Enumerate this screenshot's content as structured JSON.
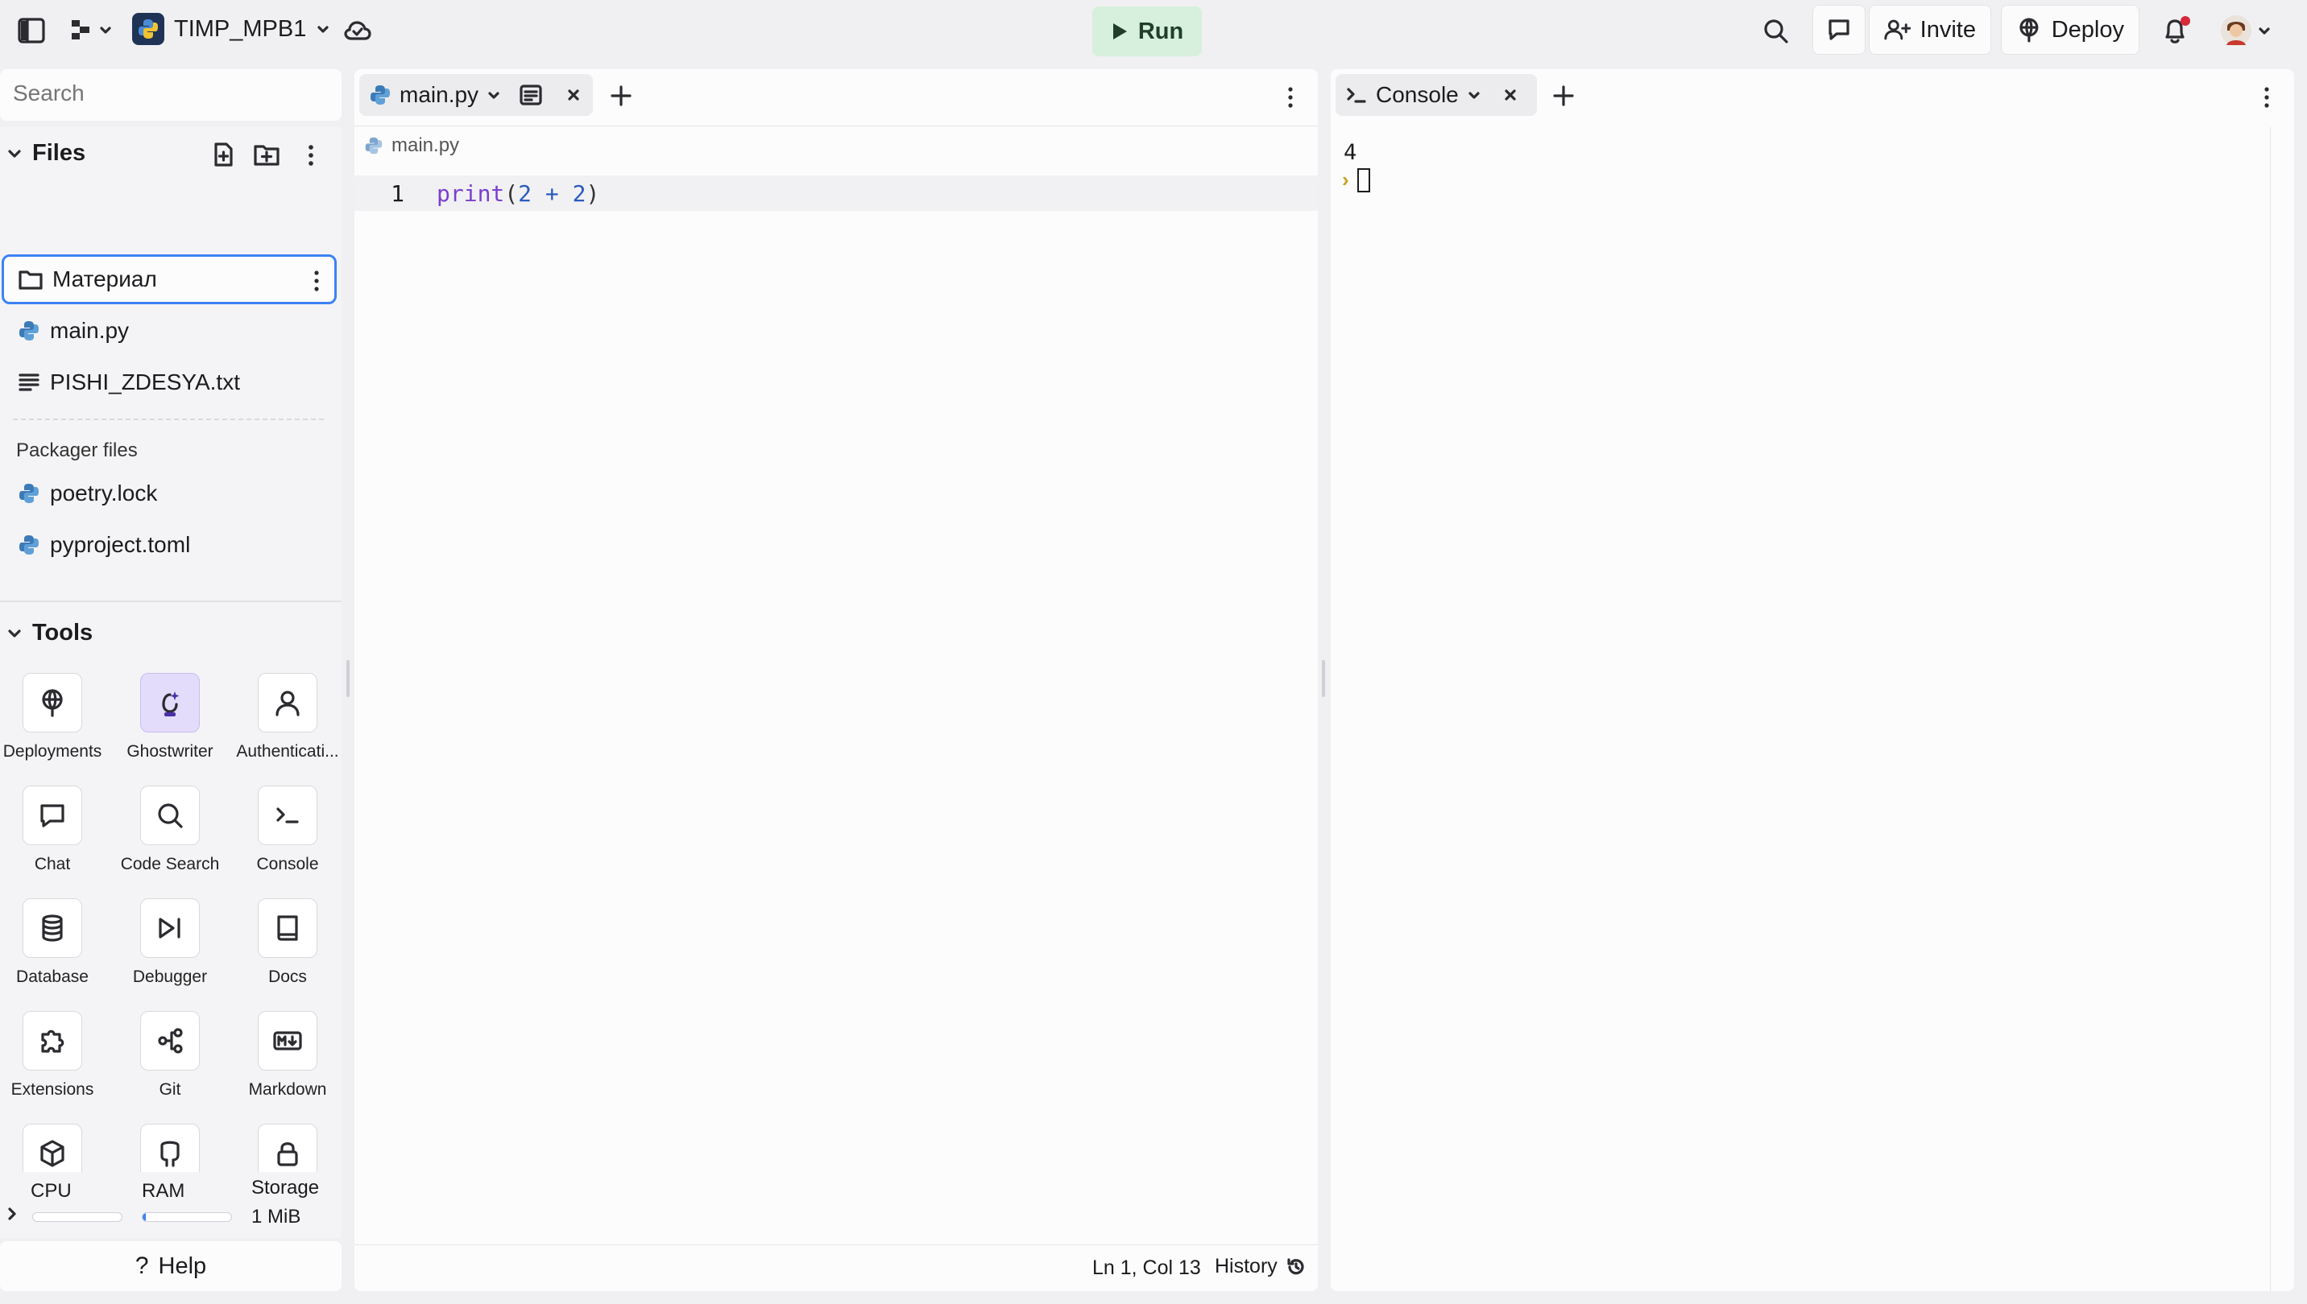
{
  "topbar": {
    "project_name": "TIMP_MPB1",
    "run_label": "Run",
    "invite_label": "Invite",
    "deploy_label": "Deploy"
  },
  "sidebar": {
    "search_placeholder": "Search",
    "files_header": "Files",
    "files": [
      {
        "name": "Материал",
        "type": "folder"
      },
      {
        "name": "main.py",
        "type": "python"
      },
      {
        "name": "PISHI_ZDESYA.txt",
        "type": "text"
      }
    ],
    "packager_header": "Packager files",
    "packager_files": [
      {
        "name": "poetry.lock",
        "type": "python"
      },
      {
        "name": "pyproject.toml",
        "type": "python"
      }
    ],
    "tools_header": "Tools",
    "tools": [
      {
        "label": "Deployments"
      },
      {
        "label": "Ghostwriter"
      },
      {
        "label": "Authenticati..."
      },
      {
        "label": "Chat"
      },
      {
        "label": "Code Search"
      },
      {
        "label": "Console"
      },
      {
        "label": "Database"
      },
      {
        "label": "Debugger"
      },
      {
        "label": "Docs"
      },
      {
        "label": "Extensions"
      },
      {
        "label": "Git"
      },
      {
        "label": "Markdown"
      }
    ],
    "resources": {
      "cpu_label": "CPU",
      "ram_label": "RAM",
      "storage_label": "Storage",
      "storage_value": "1 MiB"
    },
    "help_label": "Help"
  },
  "editor": {
    "tab_label": "main.py",
    "breadcrumb": "main.py",
    "lines": [
      {
        "number": "1",
        "fn": "print",
        "open": "(",
        "a": "2",
        "op": " + ",
        "b": "2",
        "close": ")"
      }
    ],
    "status": {
      "position": "Ln 1, Col 13",
      "history_label": "History"
    }
  },
  "console": {
    "tab_label": "Console",
    "output": "4",
    "prompt": "›"
  },
  "colors": {
    "run_bg": "#d7f0dd",
    "selected_border": "#3b82f6",
    "keyword": "#7b3fcf",
    "number": "#2c5bbd",
    "ghostwriter_bg": "#e4dcfb",
    "notification_dot": "#d6283b"
  }
}
